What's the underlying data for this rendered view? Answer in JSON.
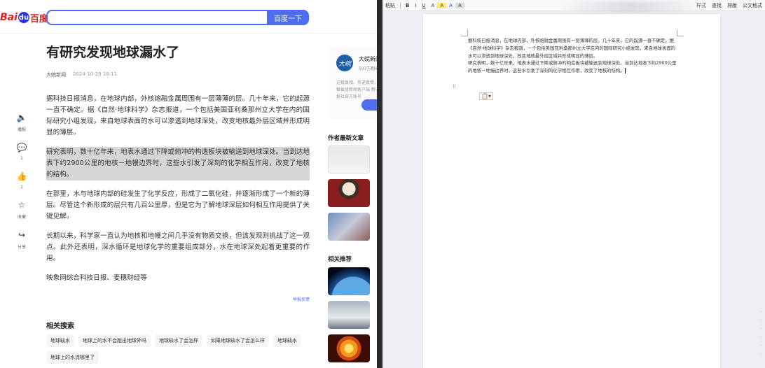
{
  "browser": {
    "logo_left": "Bai",
    "logo_paw": "du",
    "logo_right": "百度",
    "search_button": "百度一下",
    "search_value": ""
  },
  "actions": [
    {
      "icon": "speaker-icon",
      "glyph": "🔈",
      "label": "播报"
    },
    {
      "icon": "comment-icon",
      "glyph": "💬",
      "label": "1"
    },
    {
      "icon": "thumbs-up-icon",
      "glyph": "👍",
      "label": "1"
    },
    {
      "icon": "star-icon",
      "glyph": "☆",
      "label": "收藏"
    },
    {
      "icon": "share-icon",
      "glyph": "↪",
      "label": "分享"
    }
  ],
  "article": {
    "title": "有研究发现地球漏水了",
    "source": "大皖新闻",
    "date": "2024-10-29 18:11",
    "paragraphs": [
      "据科技日报消息，在地球内部，外核熔融金属周围有一层薄薄的层。几十年来，它的起源一直不确定。据《自然·地球科学》杂志报道，一个包括美国亚利桑那州立大学在内的国际研究小组发现，来自地球表面的水可以渗透到地球深处，改变地核最外层区域并形成明显的薄层。",
      "研究表明，数十亿年来，地表水通过下降或俯冲的构造板块被输送到地球深处。当到达地表下约2900公里的地核－地幔边界时，这些水引发了深刻的化学相互作用，改变了地核的结构。",
      "在那里，水与地球内部的硅发生了化学反应，形成了二氧化硅，并逐渐形成了一个新的薄层。尽管这个新形成的层只有几百公里厚，但是它为了解地球深层如何相互作用提供了关键见解。",
      "长期以来，科学家一直认为地核和地幔之间几乎没有物质交换，但该发现则挑战了这一观点。此外还表明，深水循环是地球化学的重要组成部分，水在地球深处起着更重要的作用。",
      "映象网综合科技日报、麦穗财经等"
    ],
    "feedback": "举报反馈"
  },
  "related_search": {
    "title": "相关搜索",
    "chips": [
      "地球缺水",
      "地球上的水不会跑出地球外吗",
      "地球缺水了会怎样",
      "如果地球缺水了会怎么样",
      "地球缺水",
      "地球上的水流哪里了"
    ]
  },
  "author": {
    "avatar_text": "大皖",
    "name": "大皖新闻",
    "fans": "597万粉丝",
    "desc": "迎接真相、传递真情，安徽省级新闻客户端 新安晚报社官方账号"
  },
  "right_col": {
    "latest_title": "作者最新文章",
    "related_title": "相关推荐"
  },
  "wps": {
    "toolbar": [
      "粘贴",
      "B",
      "I",
      "U",
      "A",
      "A",
      "A",
      "A",
      "样式",
      "查找",
      "排版",
      "公文格式"
    ],
    "doc_paragraphs": [
      "据科技日报消息，在地球内部，外核熔融金属周围有一层薄薄的层。几十年来，它的起源一直不确定。据《自然·地球科学》杂志报道，一个包括美国亚利桑那州立大学在内的国际研究小组发现，来自地球表面的水可以渗透到地球深处，改变地核最外层区域并形成明显的薄层。",
      "研究表明，数十亿年来，地表水通过下降或俯冲的构造板块被输送到地球深处。当到达地表下约2900公里的地核－地幔边界时，这些水引发了深刻的化学相互作用，改变了地核的结构。"
    ]
  },
  "colors": {
    "baidu_blue": "#4e6ef2",
    "baidu_red": "#de1f1f",
    "selection": "#d6d6d6"
  }
}
